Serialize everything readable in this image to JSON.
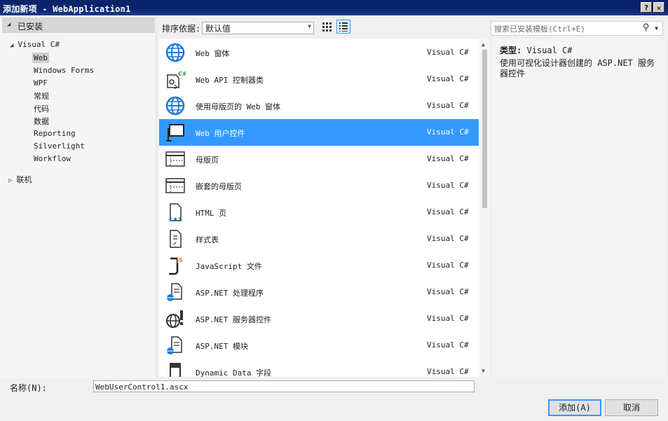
{
  "window": {
    "title": "添加新项 - WebApplication1",
    "help_label": "?",
    "close_label": "✕"
  },
  "sidebar": {
    "header": "已安装",
    "tree": [
      {
        "label": "Visual C#",
        "expanded": true
      },
      {
        "label": "Web",
        "selected": true
      },
      {
        "label": "Windows Forms"
      },
      {
        "label": "WPF"
      },
      {
        "label": "常规"
      },
      {
        "label": "代码"
      },
      {
        "label": "数据"
      },
      {
        "label": "Reporting"
      },
      {
        "label": "Silverlight"
      },
      {
        "label": "Workflow"
      },
      {
        "label": "联机",
        "expanded": false
      }
    ]
  },
  "toolbar": {
    "sort_label": "排序依据:",
    "sort_value": "默认值",
    "search_placeholder": "搜索已安装模板(Ctrl+E)"
  },
  "templates": [
    {
      "name": "Web 窗体",
      "lang": "Visual C#",
      "icon": "globe-icon"
    },
    {
      "name": "Web API 控制器类",
      "lang": "Visual C#",
      "icon": "web-api-controller-icon"
    },
    {
      "name": "使用母版页的 Web 窗体",
      "lang": "Visual C#",
      "icon": "globe-icon"
    },
    {
      "name": "Web 用户控件",
      "lang": "Visual C#",
      "icon": "user-control-icon",
      "selected": true
    },
    {
      "name": "母版页",
      "lang": "Visual C#",
      "icon": "master-page-icon"
    },
    {
      "name": "嵌套的母版页",
      "lang": "Visual C#",
      "icon": "master-page-icon"
    },
    {
      "name": "HTML 页",
      "lang": "Visual C#",
      "icon": "html-page-icon"
    },
    {
      "name": "样式表",
      "lang": "Visual C#",
      "icon": "stylesheet-icon"
    },
    {
      "name": "JavaScript 文件",
      "lang": "Visual C#",
      "icon": "javascript-file-icon"
    },
    {
      "name": "ASP.NET 处理程序",
      "lang": "Visual C#",
      "icon": "aspnet-handler-icon"
    },
    {
      "name": "ASP.NET 服务器控件",
      "lang": "Visual C#",
      "icon": "aspnet-server-control-icon"
    },
    {
      "name": "ASP.NET 模块",
      "lang": "Visual C#",
      "icon": "aspnet-module-icon"
    },
    {
      "name": "Dynamic Data 字段",
      "lang": "Visual C#",
      "icon": "dynamic-data-field-icon"
    }
  ],
  "info": {
    "type_label": "类型:",
    "type_value": "Visual C#",
    "description": "使用可视化设计器创建的 ASP.NET 服务器控件"
  },
  "footer": {
    "name_label": "名称(N):",
    "name_value": "WebUserControl1.ascx",
    "add_label": "添加(A)",
    "cancel_label": "取消"
  },
  "colors": {
    "selection": "#3399ff",
    "titlebar": "#0a246a",
    "icon_blue": "#1e7bd6"
  }
}
